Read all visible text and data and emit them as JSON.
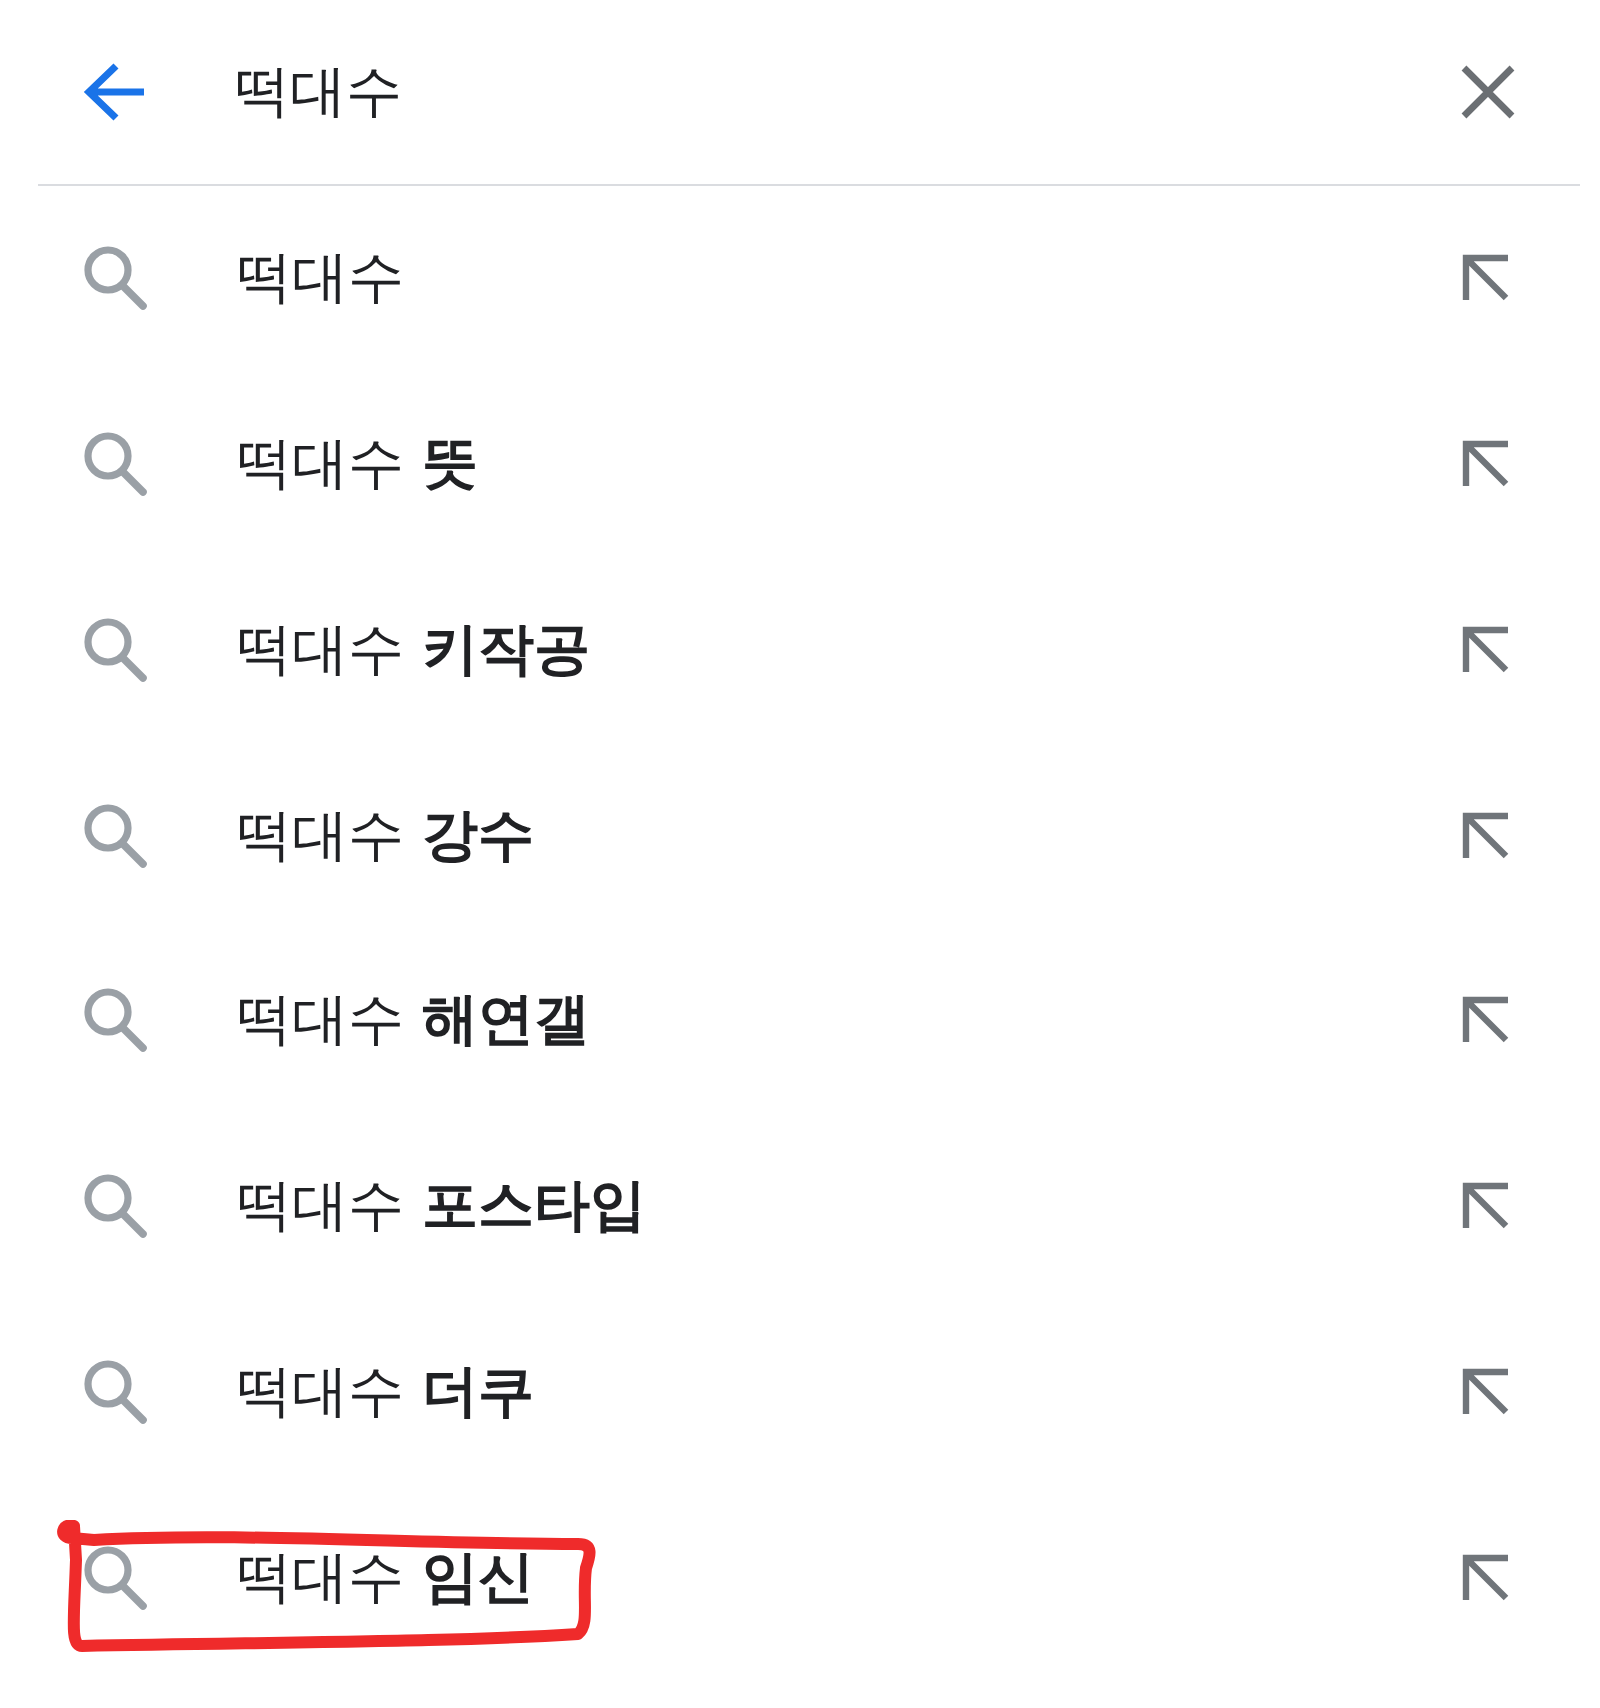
{
  "search_bar": {
    "value": "떡대수"
  },
  "suggestions": [
    {
      "text": "떡대수",
      "annotated": false
    },
    {
      "text": "떡대수 **뜻**",
      "annotated": false
    },
    {
      "text": "떡대수 **키작공**",
      "annotated": false
    },
    {
      "text": "떡대수 **강수**",
      "annotated": false
    },
    {
      "text": "떡대수 **해연갤**",
      "annotated": false
    },
    {
      "text": "떡대수 **포스타입**",
      "annotated": false
    },
    {
      "text": "떡대수 **더쿠**",
      "annotated": false
    },
    {
      "text": "떡대수 **임신**",
      "annotated": true
    }
  ]
}
